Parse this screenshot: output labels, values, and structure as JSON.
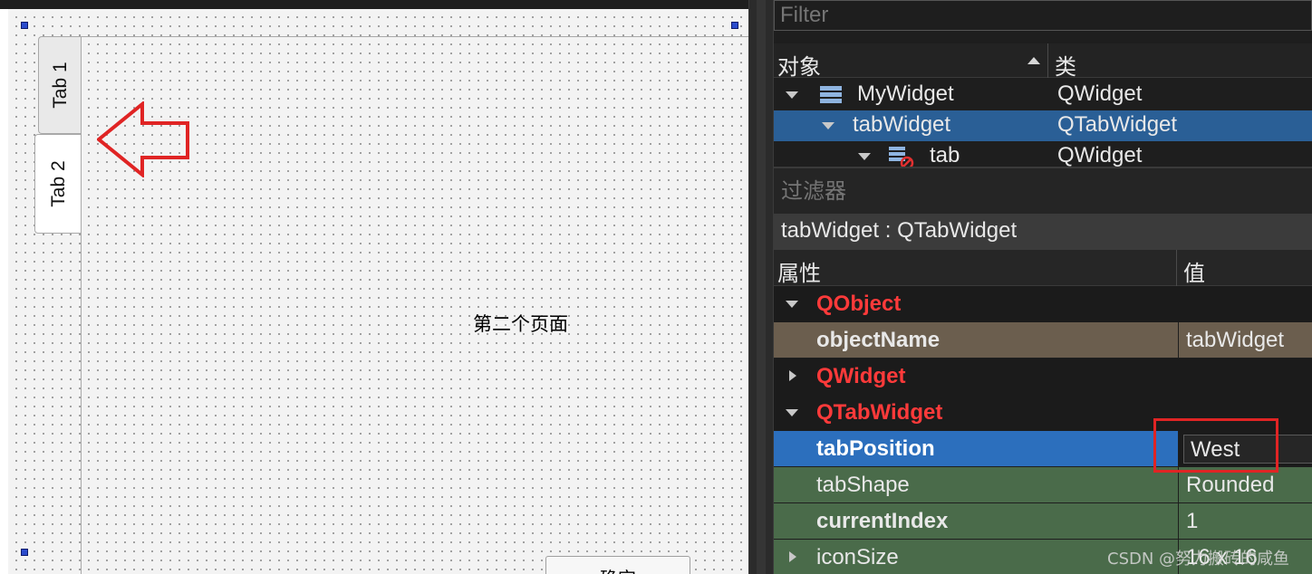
{
  "designer": {
    "tabs": [
      {
        "label": "Tab 1",
        "active": false
      },
      {
        "label": "Tab 2",
        "active": true
      }
    ],
    "page_label": "第二个页面",
    "button_label": "确定"
  },
  "object_inspector": {
    "filter_placeholder": "Filter",
    "columns": {
      "object": "对象",
      "class": "类"
    },
    "rows": [
      {
        "name": "MyWidget",
        "class": "QWidget",
        "icon": "layout-icon"
      },
      {
        "name": "tabWidget",
        "class": "QTabWidget"
      },
      {
        "name": "tab",
        "class": "QWidget",
        "icon": "broken-layout-icon"
      }
    ]
  },
  "property_editor": {
    "filter_placeholder": "过滤器",
    "object_path": "tabWidget : QTabWidget",
    "columns": {
      "property": "属性",
      "value": "值"
    },
    "groups": {
      "qobject": "QObject",
      "qwidget": "QWidget",
      "qtabwidget": "QTabWidget"
    },
    "properties": {
      "objectName": {
        "name": "objectName",
        "value": "tabWidget"
      },
      "tabPosition": {
        "name": "tabPosition",
        "value": "West"
      },
      "tabShape": {
        "name": "tabShape",
        "value": "Rounded"
      },
      "currentIndex": {
        "name": "currentIndex",
        "value": "1"
      },
      "iconSize": {
        "name": "iconSize",
        "value": "16 x 16"
      }
    }
  },
  "watermark": "CSDN @努力搬砖的咸鱼",
  "colors": {
    "selection": "#2a5f96",
    "group_text": "#ff3a3a",
    "objectName_row": "#6b5e4e",
    "qtabwidget_row": "#4a6b4a",
    "annotation_red": "#e02424"
  }
}
